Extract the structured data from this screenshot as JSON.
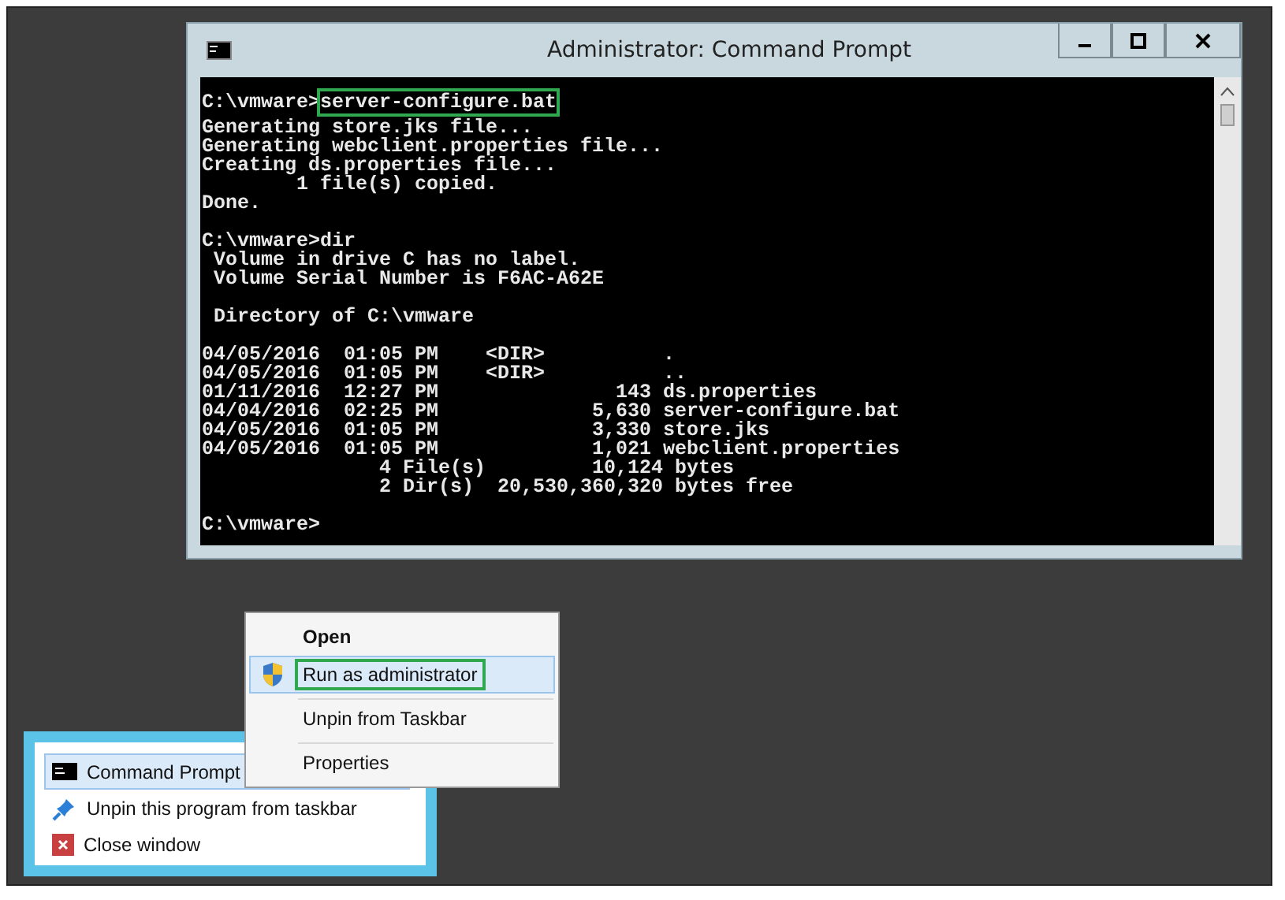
{
  "console_window": {
    "title": "Administrator: Command Prompt",
    "command": {
      "prompt": "C:\\vmware>",
      "text": "server-configure.bat",
      "highlighted": true
    },
    "lines": [
      {
        "text": "Generating store.jks file...",
        "gap_before": false
      },
      {
        "text": "Generating webclient.properties file...",
        "gap_before": false
      },
      {
        "text": "Creating ds.properties file...",
        "gap_before": false
      },
      {
        "text": "        1 file(s) copied.",
        "gap_before": false
      },
      {
        "text": "Done.",
        "gap_before": false
      },
      {
        "text": "C:\\vmware>dir",
        "gap_before": true
      },
      {
        "text": " Volume in drive C has no label.",
        "gap_before": false
      },
      {
        "text": " Volume Serial Number is F6AC-A62E",
        "gap_before": false
      },
      {
        "text": " Directory of C:\\vmware",
        "gap_before": true
      },
      {
        "text": "04/05/2016  01:05 PM    <DIR>          .",
        "gap_before": true
      },
      {
        "text": "04/05/2016  01:05 PM    <DIR>          ..",
        "gap_before": false
      },
      {
        "text": "01/11/2016  12:27 PM               143 ds.properties",
        "gap_before": false
      },
      {
        "text": "04/04/2016  02:25 PM             5,630 server-configure.bat",
        "gap_before": false
      },
      {
        "text": "04/05/2016  01:05 PM             3,330 store.jks",
        "gap_before": false
      },
      {
        "text": "04/05/2016  01:05 PM             1,021 webclient.properties",
        "gap_before": false
      },
      {
        "text": "               4 File(s)         10,124 bytes",
        "gap_before": false
      },
      {
        "text": "               2 Dir(s)  20,530,360,320 bytes free",
        "gap_before": false
      },
      {
        "text": "C:\\vmware>",
        "gap_before": true
      }
    ]
  },
  "context_menu": {
    "items": [
      {
        "label": "Open",
        "kind": "default",
        "selected": false,
        "highlighted": false,
        "separator_before": false
      },
      {
        "label": "Run as administrator",
        "kind": "shield",
        "selected": true,
        "highlighted": true,
        "separator_before": false
      },
      {
        "label": "Unpin from Taskbar",
        "kind": "plain",
        "selected": false,
        "highlighted": false,
        "separator_before": true
      },
      {
        "label": "Properties",
        "kind": "plain",
        "selected": false,
        "highlighted": false,
        "separator_before": true
      }
    ]
  },
  "jump_list": {
    "items": [
      {
        "label": "Command Prompt",
        "kind": "program",
        "selected": true
      },
      {
        "label": "Unpin this program from taskbar",
        "kind": "unpin",
        "selected": false
      },
      {
        "label": "Close window",
        "kind": "close",
        "selected": false
      }
    ]
  }
}
